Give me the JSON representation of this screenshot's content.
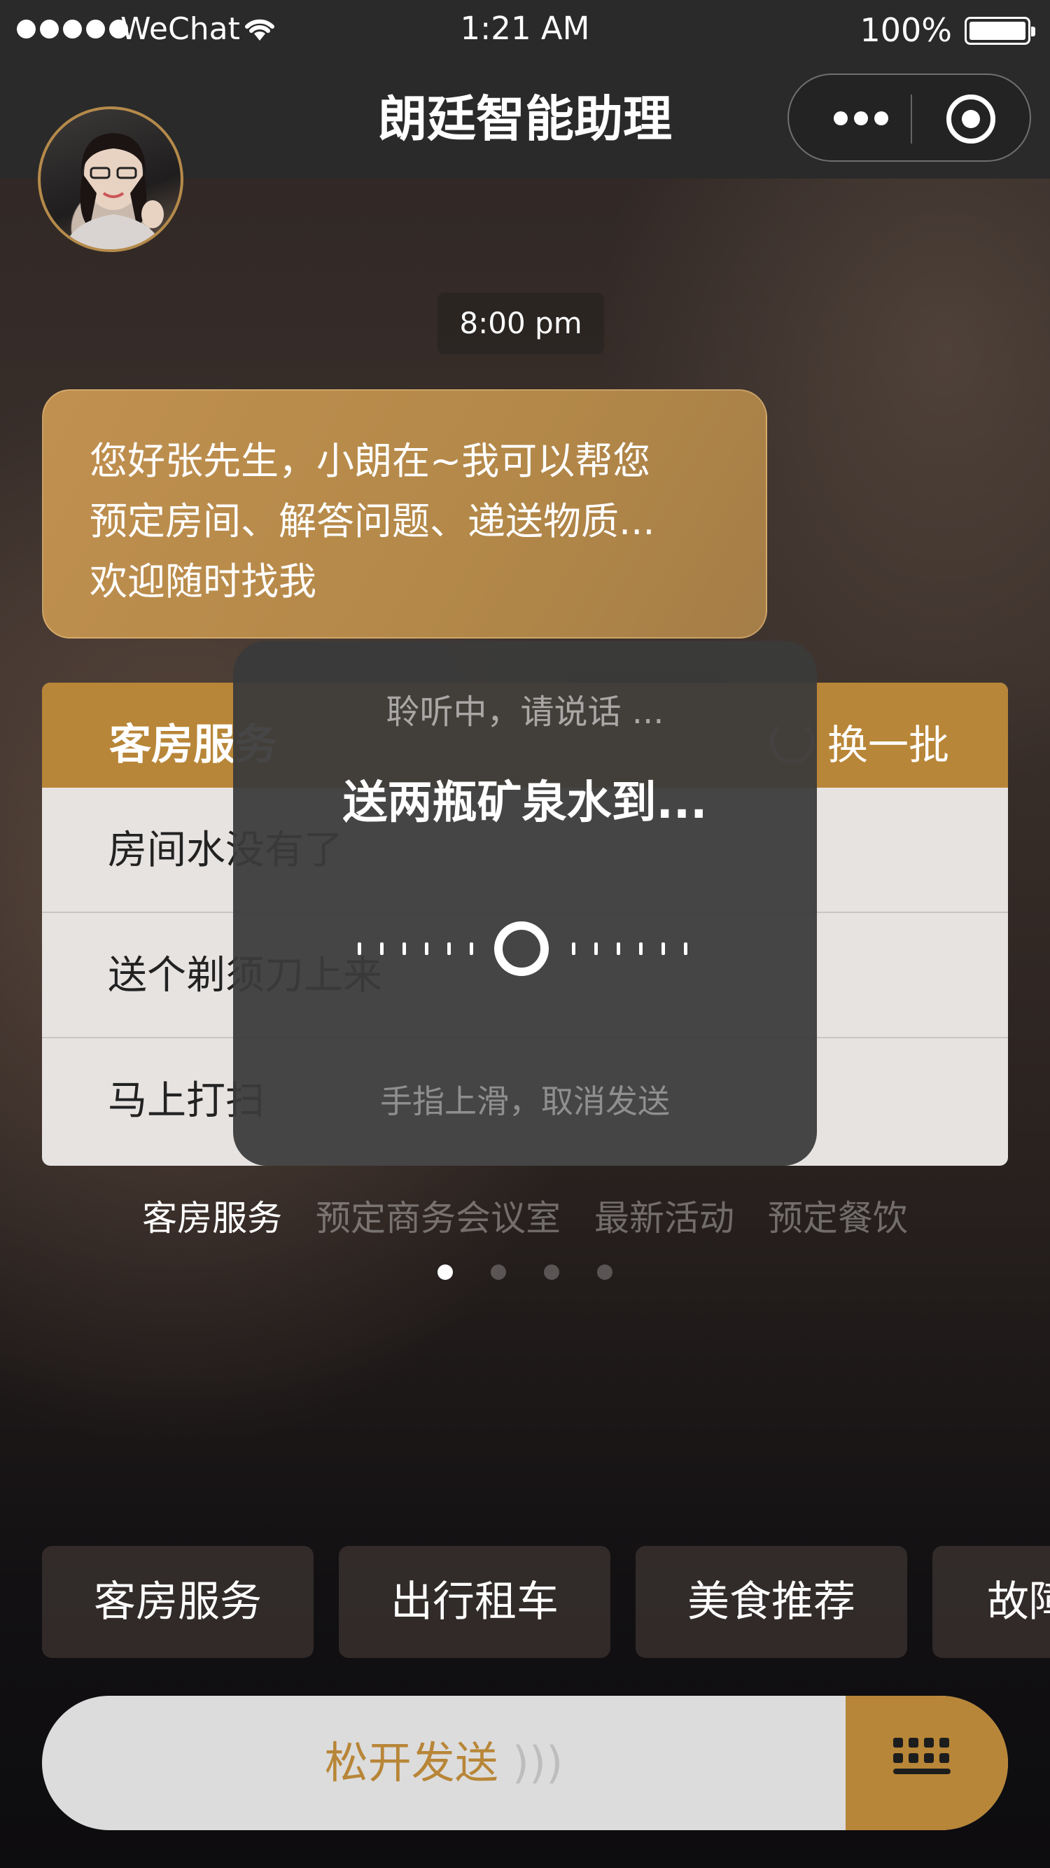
{
  "status_bar": {
    "carrier": "WeChat",
    "time": "1:21 AM",
    "battery": "100%"
  },
  "nav": {
    "title": "朗廷智能助理"
  },
  "chat": {
    "timestamp": "8:00 pm",
    "bubble_lines": [
      "您好张先生，小朗在~我可以帮您",
      "预定房间、解答问题、递送物质...",
      "欢迎随时找我"
    ]
  },
  "card": {
    "title": "客房服务",
    "refresh_label": "换一批",
    "rows": [
      "房间水没有了",
      "送个剃须刀上来",
      "马上打扫"
    ]
  },
  "categories": {
    "items": [
      "客房服务",
      "预定商务会议室",
      "最新活动",
      "预定餐饮"
    ],
    "active_index": 0,
    "page_count": 4,
    "current_page": 1
  },
  "quick_actions": [
    "客房服务",
    "出行租车",
    "美食推荐",
    "故障"
  ],
  "input_bar": {
    "hold_label": "松开发送",
    "wave_glyph": ")))"
  },
  "voice_overlay": {
    "listening": "聆听中，请说话 ...",
    "recognized": "送两瓶矿泉水到...",
    "cancel_hint": "手指上滑，取消发送"
  },
  "colors": {
    "accent": "#b88638",
    "bubble": "#b38848",
    "overlay": "#3a3a3a"
  }
}
